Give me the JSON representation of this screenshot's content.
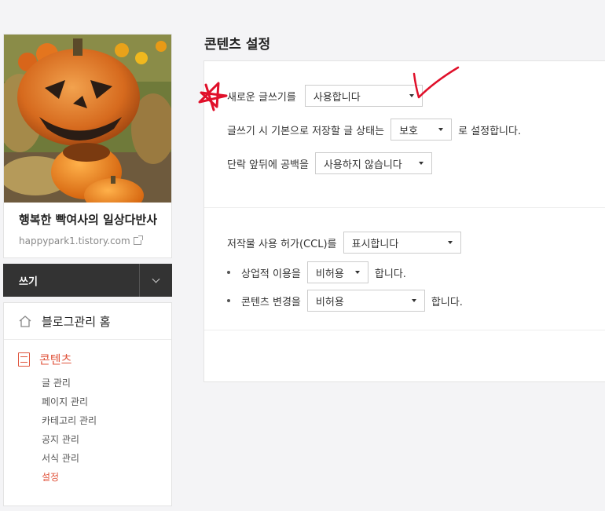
{
  "sidebar": {
    "blog_title": "행복한 빡여사의 일상다반사",
    "blog_url": "happypark1.tistory.com",
    "write_label": "쓰기",
    "home_label": "블로그관리 홈",
    "content_label": "콘텐츠",
    "submenu": [
      "글 관리",
      "페이지 관리",
      "카테고리 관리",
      "공지 관리",
      "서식 관리",
      "설정"
    ],
    "active_item": "설정"
  },
  "main": {
    "title": "콘텐츠 설정",
    "new_editor_label": "새로운 글쓰기를",
    "new_editor_value": "사용합니다",
    "default_status_prefix": "글쓰기 시 기본으로 저장할 글 상태는",
    "default_status_value": "보호",
    "default_status_suffix": "로 설정합니다.",
    "paragraph_spacing_label": "단락 앞뒤에 공백을",
    "paragraph_spacing_value": "사용하지 않습니다",
    "ccl_label": "저작물 사용 허가(CCL)를",
    "ccl_value": "표시합니다",
    "commercial_label": "상업적 이용을",
    "commercial_value": "비허용",
    "commercial_suffix": "합니다.",
    "modify_label": "콘텐츠 변경을",
    "modify_value": "비허용",
    "modify_suffix": "합니다."
  },
  "colors": {
    "accent": "#e0543c",
    "annotation": "#e0102a",
    "dark_bar": "#333333"
  }
}
